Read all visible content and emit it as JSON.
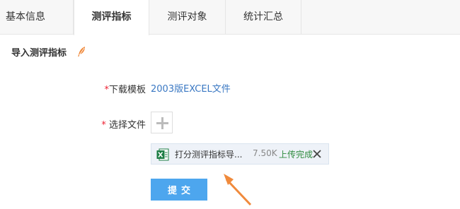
{
  "tabs": [
    {
      "label": "基本信息",
      "active": false
    },
    {
      "label": "测评指标",
      "active": true
    },
    {
      "label": "测评对象",
      "active": false
    },
    {
      "label": "统计汇总",
      "active": false
    }
  ],
  "section": {
    "title": "导入测评指标",
    "icon": "feather-icon"
  },
  "form": {
    "required_mark": "*",
    "template_label": "下载模板",
    "template_link": "2003版EXCEL文件",
    "file_label": "选择文件",
    "upload_icon": "plus-icon",
    "file": {
      "icon": "excel-icon",
      "name": "打分测评指标导...",
      "size": "7.50K",
      "status": "上传完成",
      "remove_icon": "close-icon"
    },
    "submit_label": "提交"
  },
  "colors": {
    "link": "#3a78c3",
    "submit_bg": "#4da6ee",
    "success": "#2e8b3e",
    "required": "#e23",
    "arrow": "#f08a3c"
  }
}
